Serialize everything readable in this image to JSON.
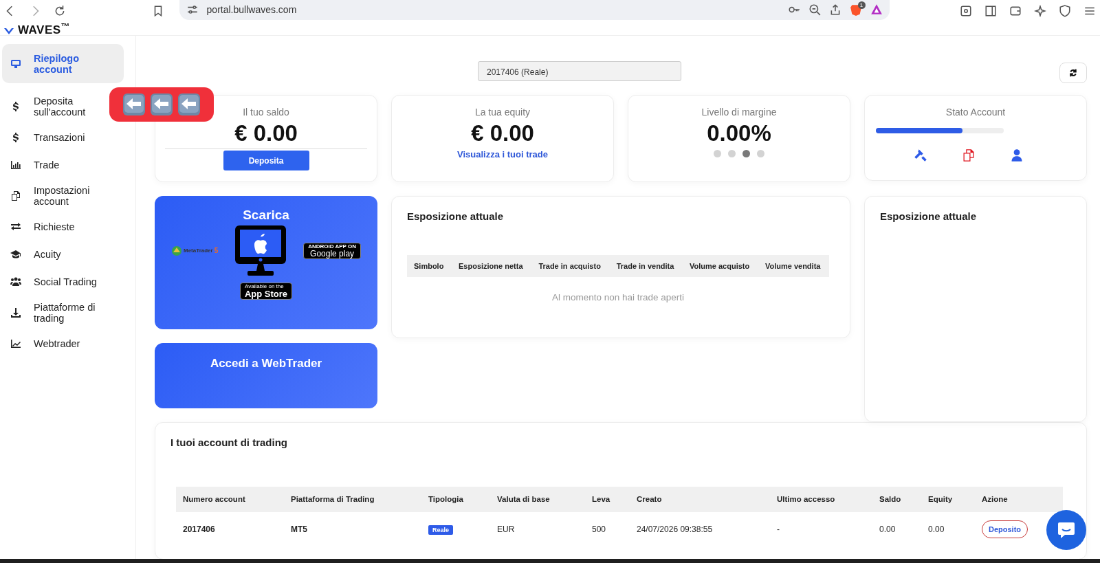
{
  "browser": {
    "url": "portal.bullwaves.com",
    "shield_badge": "1"
  },
  "logo": {
    "text": "WAVES$^{™}$"
  },
  "sidebar": {
    "items": [
      {
        "label": "Riepilogo account",
        "selected": true
      },
      {
        "label": "Deposita sull'account",
        "selected": false
      },
      {
        "label": "Transazioni",
        "selected": false
      },
      {
        "label": "Trade",
        "selected": false
      },
      {
        "label": "Impostazioni account",
        "selected": false
      },
      {
        "label": "Richieste",
        "selected": false
      },
      {
        "label": "Acuity",
        "selected": false
      },
      {
        "label": "Social Trading",
        "selected": false
      },
      {
        "label": "Piattaforme di trading",
        "selected": false
      },
      {
        "label": "Webtrader",
        "selected": false
      }
    ]
  },
  "account_select": {
    "value": "2017406 (Reale)"
  },
  "stat_cards": [
    {
      "kind": "button",
      "label": "Il tuo saldo",
      "value": "€ 0.00",
      "action": "Deposita"
    },
    {
      "kind": "link",
      "label": "La tua equity",
      "value": "€ 0.00",
      "action": "Visualizza i tuoi trade"
    },
    {
      "kind": "dots",
      "label": "Livello di margine",
      "value": "0.00%",
      "dots": [
        {
          "selected": false
        },
        {
          "selected": false
        },
        {
          "selected": true
        },
        {
          "selected": false
        }
      ]
    }
  ],
  "status_card": {
    "label": "Stato Account",
    "level": 0.68
  },
  "download_card": {
    "title": "Scarica",
    "metatrader": {
      "name": "MetaTrader",
      "version": "5"
    },
    "google_play": {
      "top": "ANDROID APP ON",
      "main": "Google play"
    },
    "app_store": {
      "top": "Available on the",
      "main": "App Store"
    }
  },
  "webtrader_card": {
    "title": "Accedi a WebTrader"
  },
  "exposure": {
    "title": "Esposizione attuale",
    "columns": [
      "Simbolo",
      "Esposizione netta",
      "Trade in acquisto",
      "Trade in vendita",
      "Volume acquisto",
      "Volume vendita"
    ],
    "empty": "Al momento non hai trade aperti"
  },
  "exposure_side": {
    "title": "Esposizione attuale"
  },
  "accounts": {
    "title": "I tuoi account di trading",
    "columns": [
      "Numero account",
      "Piattaforma di Trading",
      "Tipologia",
      "Valuta di base",
      "Leva",
      "Creato",
      "Ultimo accesso",
      "Saldo",
      "Equity",
      "Azione"
    ],
    "rows": [
      {
        "cells": [
          {
            "kind": "bold",
            "text": "2017406"
          },
          {
            "kind": "bold",
            "text": "MT5"
          },
          {
            "kind": "badge",
            "text": "Reale"
          },
          {
            "kind": "text",
            "text": "EUR"
          },
          {
            "kind": "text",
            "text": "500"
          },
          {
            "kind": "text",
            "text": "24/07/2026 09:38:55"
          },
          {
            "kind": "text",
            "text": "-"
          },
          {
            "kind": "text",
            "text": "0.00"
          },
          {
            "kind": "text",
            "text": "0.00"
          },
          {
            "kind": "button",
            "text": "Deposito"
          }
        ]
      }
    ]
  }
}
